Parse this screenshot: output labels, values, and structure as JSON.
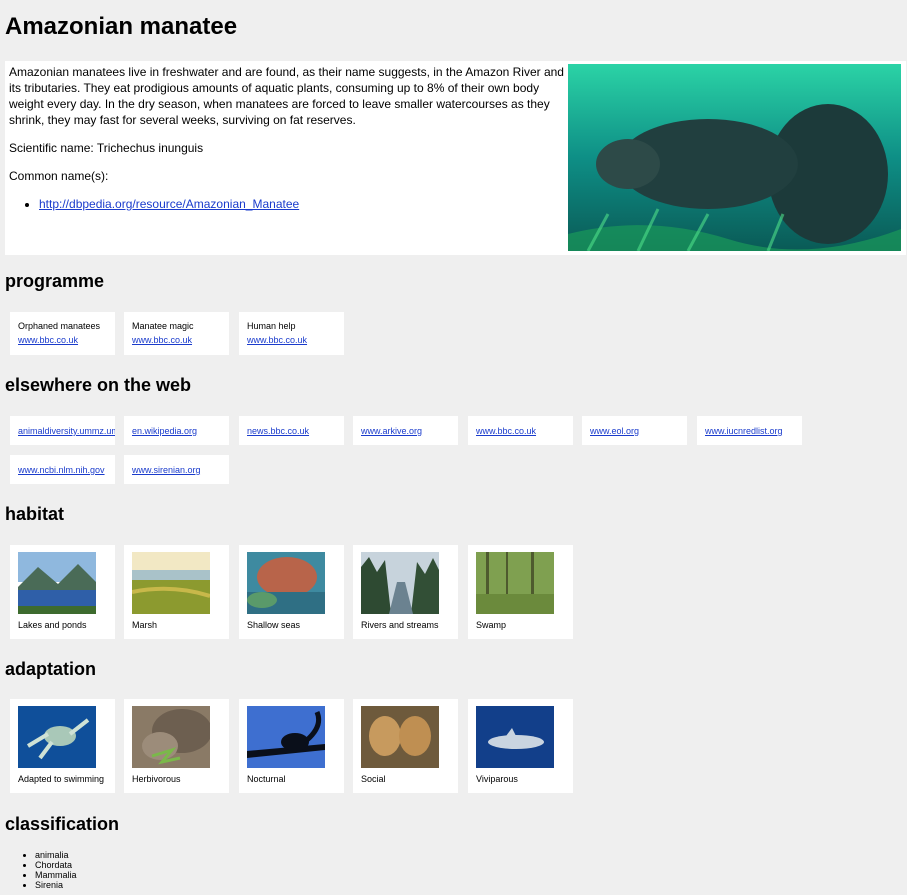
{
  "title": "Amazonian manatee",
  "intro": {
    "description": "Amazonian manatees live in freshwater and are found, as their name suggests, in the Amazon River and its tributaries. They eat prodigious amounts of aquatic plants, consuming up to 8% of their own body weight every day. In the dry season, when manatees are forced to leave smaller watercourses as they shrink, they may fast for several weeks, surviving on fat reserves.",
    "scientific_name": "Scientific name: Trichechus inunguis",
    "common_names_label": "Common name(s):",
    "common_names": [
      "http://dbpedia.org/resource/Amazonian_Manatee"
    ]
  },
  "programme": {
    "heading": "programme",
    "items": [
      {
        "title": "Orphaned manatees",
        "link": "www.bbc.co.uk"
      },
      {
        "title": "Manatee magic",
        "link": "www.bbc.co.uk"
      },
      {
        "title": "Human help",
        "link": "www.bbc.co.uk"
      }
    ]
  },
  "web": {
    "heading": "elsewhere on the web",
    "links": [
      "animaldiversity.ummz.umich.edu",
      "en.wikipedia.org",
      "news.bbc.co.uk",
      "www.arkive.org",
      "www.bbc.co.uk",
      "www.eol.org",
      "www.iucnredlist.org",
      "www.ncbi.nlm.nih.gov",
      "www.sirenian.org"
    ]
  },
  "habitat": {
    "heading": "habitat",
    "items": [
      "Lakes and ponds",
      "Marsh",
      "Shallow seas",
      "Rivers and streams",
      "Swamp"
    ]
  },
  "adaptation": {
    "heading": "adaptation",
    "items": [
      "Adapted to swimming",
      "Herbivorous",
      "Nocturnal",
      "Social",
      "Viviparous"
    ]
  },
  "classification": {
    "heading": "classification",
    "items": [
      "animalia",
      "Chordata",
      "Mammalia",
      "Sirenia"
    ]
  },
  "colors": {
    "background": "#efefef",
    "link": "#1a3bcc",
    "card": "#ffffff"
  }
}
